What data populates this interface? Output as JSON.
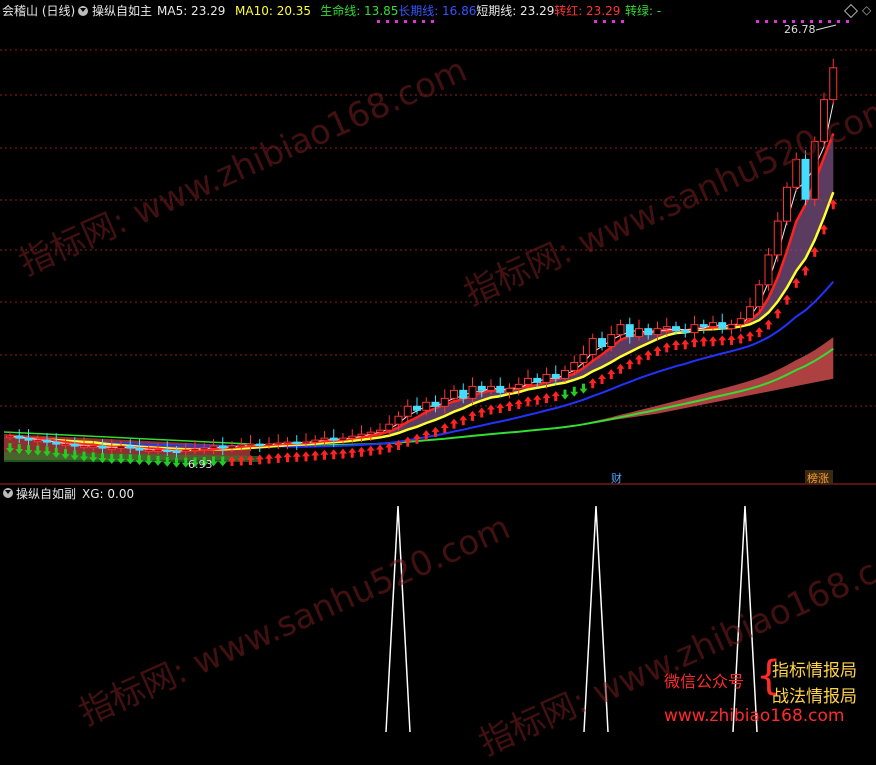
{
  "main_panel": {
    "stock_name": "会稽山 (日线)",
    "indicator_name": "操纵自如主",
    "indicators": [
      {
        "label": "MA5: 23.29",
        "color": "#e8e8e8"
      },
      {
        "label": "MA10: 20.35",
        "color": "#ffff33"
      },
      {
        "label": "生命线: 13.85",
        "color": "#33dd33"
      },
      {
        "label": "长期线: 16.86",
        "color": "#3355ff"
      },
      {
        "label": "短期线: 23.29",
        "color": "#e8e8e8"
      },
      {
        "label": "转红: 23.29",
        "color": "#ff3333"
      },
      {
        "label": "转绿: -",
        "color": "#33dd33"
      }
    ],
    "price_high_label": "26.78",
    "price_low_label": "6.93",
    "event_labels": [
      {
        "text": "财",
        "color": "#4da6ff"
      },
      {
        "text": "榜涨",
        "color": "#ff9933"
      }
    ]
  },
  "sub_panel": {
    "indicator_name": "操纵自如副",
    "value_label": "XG: 0.00"
  },
  "watermarks": [
    "指标网: www.zhibiao168.com",
    "指标网: www.sanhu520.com"
  ],
  "promo": {
    "wechat_label": "微信公众号",
    "brand_1": "指标情报局",
    "brand_2": "战法情报局",
    "website": "www.zhibiao168.com"
  },
  "chart_data": {
    "type": "candlestick",
    "title": "会稽山 (日线)",
    "price_high": 26.78,
    "price_low": 6.93,
    "closes": [
      7.7,
      7.6,
      7.5,
      7.5,
      7.4,
      7.3,
      7.3,
      7.2,
      7.2,
      7.2,
      7.1,
      7.1,
      7.2,
      7.1,
      7.0,
      7.0,
      7.0,
      6.95,
      6.93,
      7.0,
      7.05,
      7.1,
      7.2,
      7.1,
      7.2,
      7.25,
      7.3,
      7.25,
      7.3,
      7.35,
      7.4,
      7.35,
      7.4,
      7.5,
      7.6,
      7.5,
      7.6,
      7.7,
      7.8,
      7.9,
      8.0,
      8.3,
      8.7,
      9.2,
      9.0,
      9.4,
      9.2,
      9.6,
      10.0,
      9.6,
      10.2,
      10.0,
      10.2,
      9.9,
      10.1,
      10.3,
      10.6,
      10.4,
      10.8,
      10.6,
      11.0,
      11.4,
      11.8,
      12.6,
      12.2,
      12.8,
      13.3,
      12.7,
      13.1,
      12.8,
      13.1,
      13.2,
      13.0,
      12.9,
      13.3,
      13.2,
      13.4,
      13.1,
      13.3,
      13.6,
      14.2,
      15.3,
      16.8,
      18.5,
      20.2,
      21.6,
      19.6,
      22.5,
      24.6,
      26.2
    ],
    "sub_signal": {
      "series": "XG",
      "peaks_at_bar": [
        42,
        67,
        81
      ],
      "peak_value": 1,
      "value": 0.0
    }
  }
}
